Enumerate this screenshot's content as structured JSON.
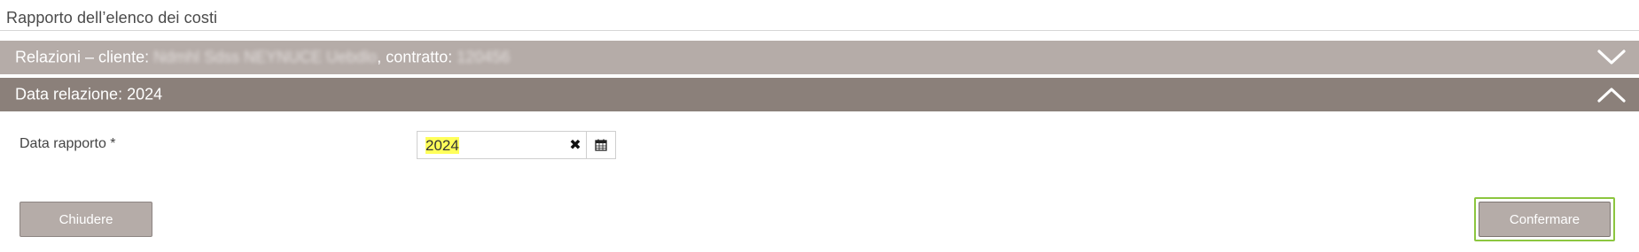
{
  "page": {
    "title": "Rapporto dell’elenco dei costi"
  },
  "sections": {
    "relations": {
      "prefix": "Relazioni – cliente:",
      "client_redacted": "Ndmhl Sdss NEYNUCE Uebdlo",
      "contract_label": "contratto:",
      "contract_redacted": "120456",
      "state": "collapsed",
      "toggle_icon": "chevron-down-icon"
    },
    "report_date": {
      "label": "Data relazione: 2024",
      "state": "expanded",
      "toggle_icon": "chevron-up-icon"
    }
  },
  "form": {
    "date_label": "Data rapporto *",
    "date_value": "2024",
    "clear_icon": "clear-icon",
    "calendar_icon": "calendar-icon",
    "highlight_color": "#ffff5a"
  },
  "buttons": {
    "close_label": "Chiudere",
    "confirm_label": "Confermare"
  },
  "colors": {
    "bar_light": "#b5aca8",
    "bar_dark": "#8b807a",
    "focus_outline": "#8cc63f"
  }
}
